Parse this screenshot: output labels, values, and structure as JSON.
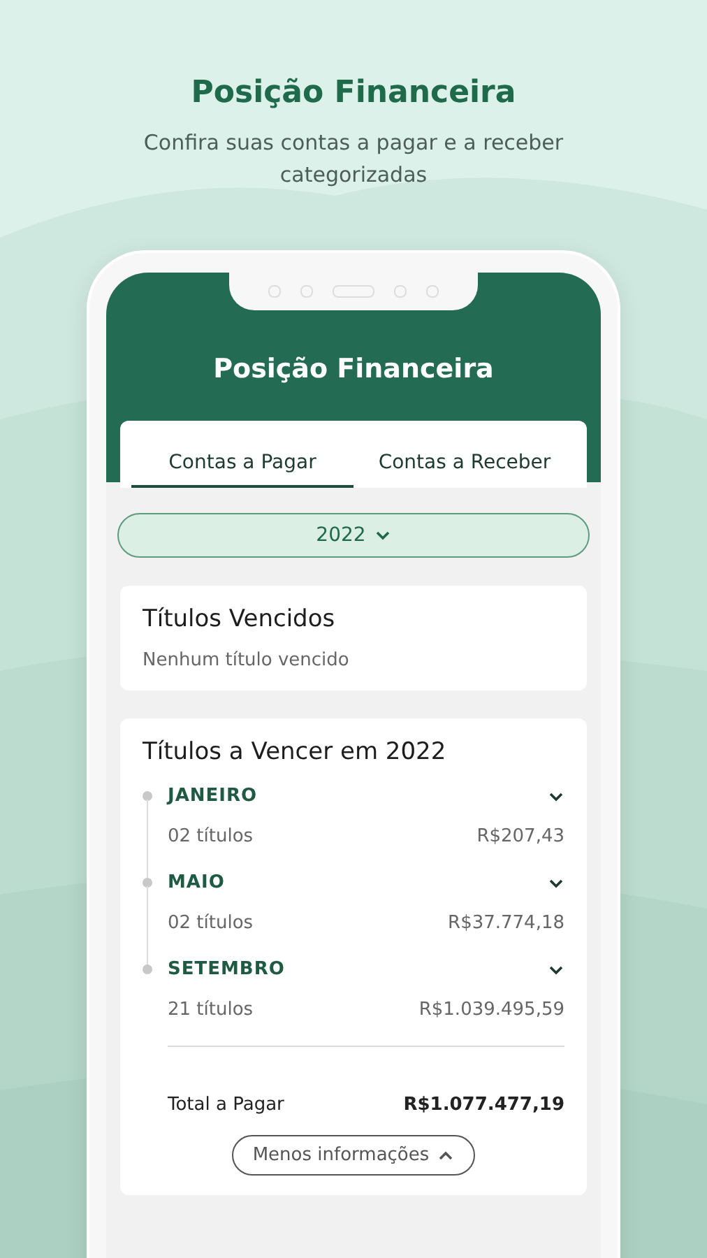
{
  "headline": {
    "title": "Posição Financeira",
    "subtitle": "Confira suas contas a pagar e a receber categorizadas"
  },
  "app": {
    "title": "Posição Financeira",
    "tabs": [
      {
        "label": "Contas a Pagar",
        "selected": true
      },
      {
        "label": "Contas a Receber",
        "selected": false
      }
    ],
    "year_select": {
      "value": "2022"
    },
    "overdue": {
      "title": "Títulos Vencidos",
      "message": "Nenhum título vencido"
    },
    "upcoming": {
      "title": "Títulos a Vencer em 2022",
      "months": [
        {
          "name": "JANEIRO",
          "count": "02 títulos",
          "amount": "R$207,43"
        },
        {
          "name": "MAIO",
          "count": "02 títulos",
          "amount": "R$37.774,18"
        },
        {
          "name": "SETEMBRO",
          "count": "21 títulos",
          "amount": "R$1.039.495,59"
        }
      ],
      "total_label": "Total a Pagar",
      "total_value": "R$1.077.477,19",
      "less_button": "Menos informações"
    }
  }
}
